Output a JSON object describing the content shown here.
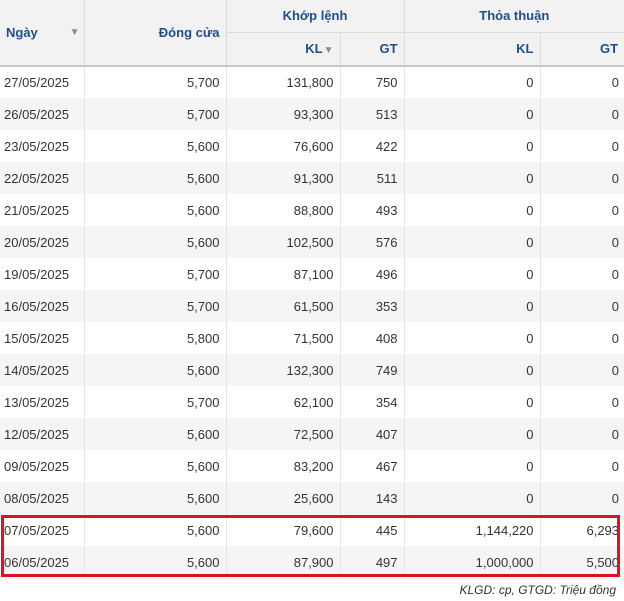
{
  "table": {
    "headers": {
      "date": "Ngày",
      "close": "Đóng cửa",
      "matched_group": "Khớp lệnh",
      "negotiated_group": "Thỏa thuận",
      "kl": "KL",
      "gt": "GT"
    },
    "icons": {
      "date_sort": "sort-triangle-icon",
      "kl_sort": "sort-triangle-icon"
    },
    "rows": [
      {
        "date": "27/05/2025",
        "close": "5,700",
        "match_kl": "131,800",
        "match_gt": "750",
        "neg_kl": "0",
        "neg_gt": "0"
      },
      {
        "date": "26/05/2025",
        "close": "5,700",
        "match_kl": "93,300",
        "match_gt": "513",
        "neg_kl": "0",
        "neg_gt": "0"
      },
      {
        "date": "23/05/2025",
        "close": "5,600",
        "match_kl": "76,600",
        "match_gt": "422",
        "neg_kl": "0",
        "neg_gt": "0"
      },
      {
        "date": "22/05/2025",
        "close": "5,600",
        "match_kl": "91,300",
        "match_gt": "511",
        "neg_kl": "0",
        "neg_gt": "0"
      },
      {
        "date": "21/05/2025",
        "close": "5,600",
        "match_kl": "88,800",
        "match_gt": "493",
        "neg_kl": "0",
        "neg_gt": "0"
      },
      {
        "date": "20/05/2025",
        "close": "5,600",
        "match_kl": "102,500",
        "match_gt": "576",
        "neg_kl": "0",
        "neg_gt": "0"
      },
      {
        "date": "19/05/2025",
        "close": "5,700",
        "match_kl": "87,100",
        "match_gt": "496",
        "neg_kl": "0",
        "neg_gt": "0"
      },
      {
        "date": "16/05/2025",
        "close": "5,700",
        "match_kl": "61,500",
        "match_gt": "353",
        "neg_kl": "0",
        "neg_gt": "0"
      },
      {
        "date": "15/05/2025",
        "close": "5,800",
        "match_kl": "71,500",
        "match_gt": "408",
        "neg_kl": "0",
        "neg_gt": "0"
      },
      {
        "date": "14/05/2025",
        "close": "5,600",
        "match_kl": "132,300",
        "match_gt": "749",
        "neg_kl": "0",
        "neg_gt": "0"
      },
      {
        "date": "13/05/2025",
        "close": "5,700",
        "match_kl": "62,100",
        "match_gt": "354",
        "neg_kl": "0",
        "neg_gt": "0"
      },
      {
        "date": "12/05/2025",
        "close": "5,600",
        "match_kl": "72,500",
        "match_gt": "407",
        "neg_kl": "0",
        "neg_gt": "0"
      },
      {
        "date": "09/05/2025",
        "close": "5,600",
        "match_kl": "83,200",
        "match_gt": "467",
        "neg_kl": "0",
        "neg_gt": "0"
      },
      {
        "date": "08/05/2025",
        "close": "5,600",
        "match_kl": "25,600",
        "match_gt": "143",
        "neg_kl": "0",
        "neg_gt": "0"
      },
      {
        "date": "07/05/2025",
        "close": "5,600",
        "match_kl": "79,600",
        "match_gt": "445",
        "neg_kl": "1,144,220",
        "neg_gt": "6,293"
      },
      {
        "date": "06/05/2025",
        "close": "5,600",
        "match_kl": "87,900",
        "match_gt": "497",
        "neg_kl": "1,000,000",
        "neg_gt": "5,500"
      }
    ]
  },
  "footnote": "KLGD: cp, GTGD: Triệu đồng",
  "colors": {
    "header_text": "#1f4e8c",
    "highlight": "#e3101d",
    "stripe": "#f5f5f5"
  }
}
